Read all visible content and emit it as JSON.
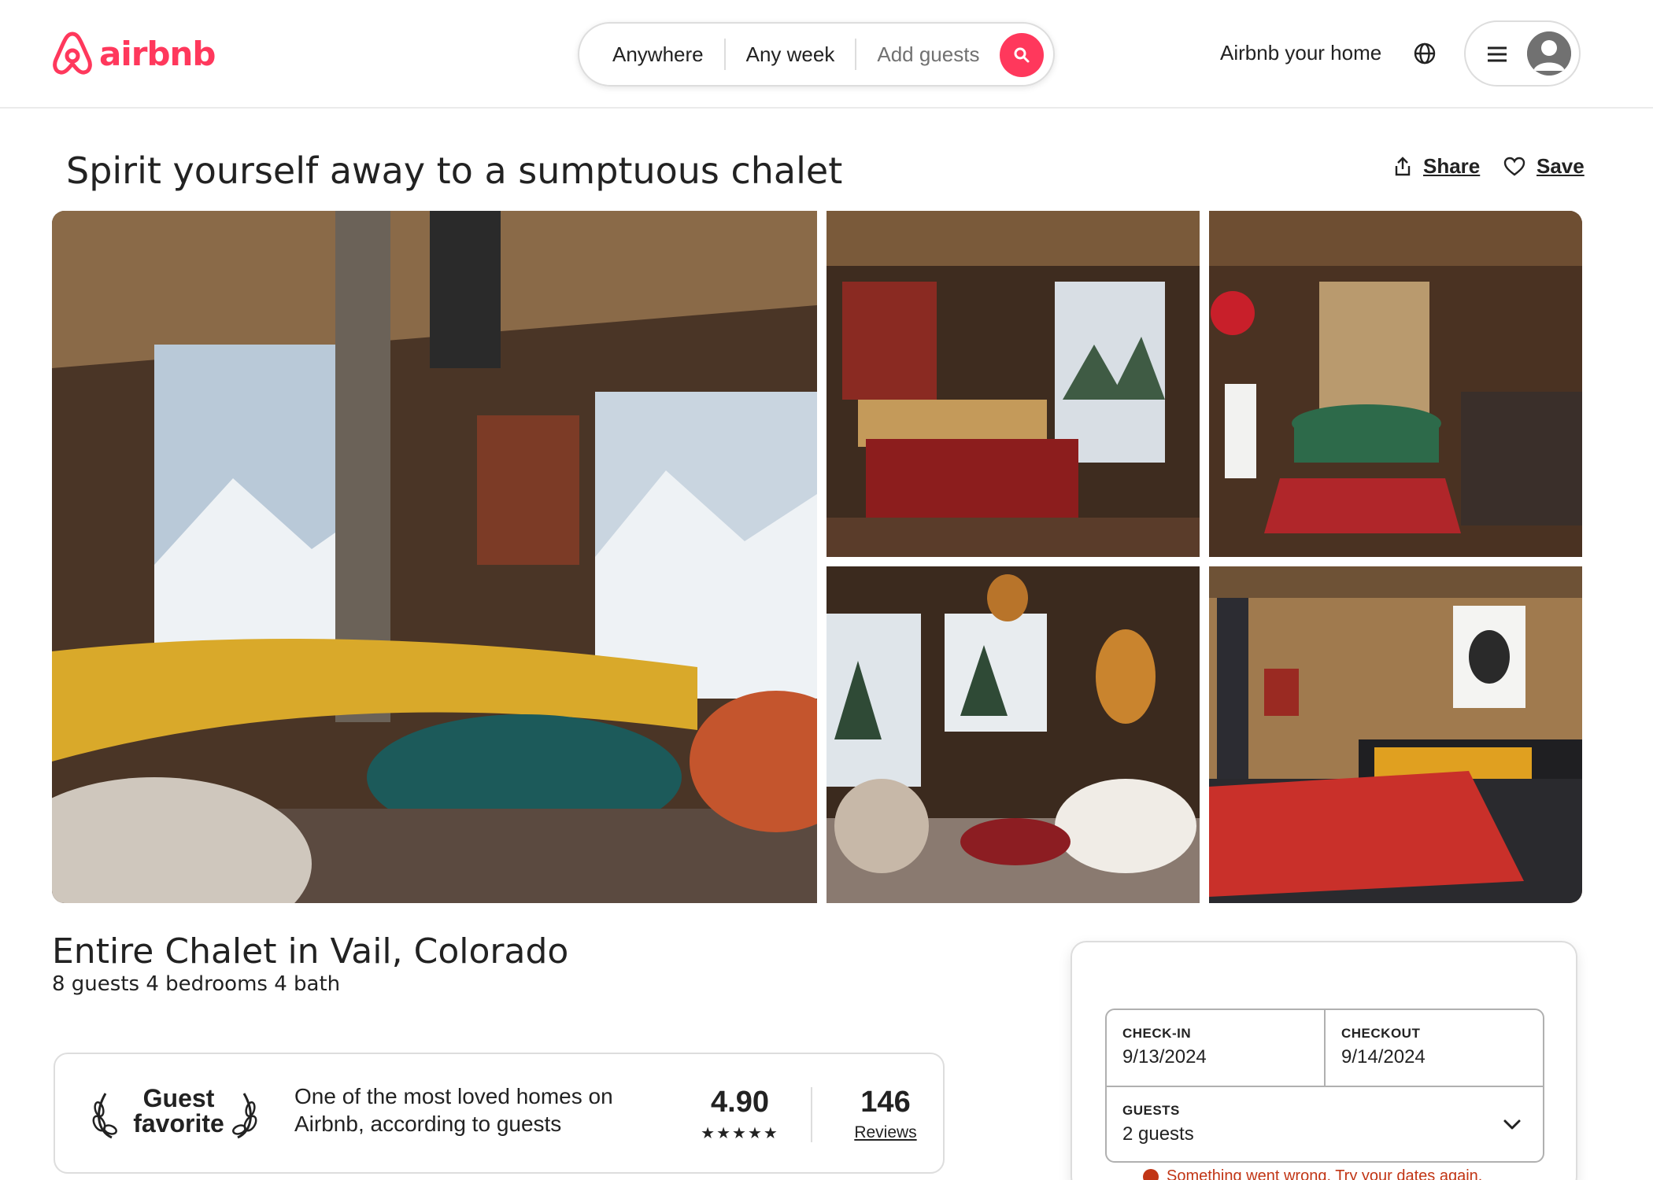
{
  "header": {
    "logo_text": "airbnb",
    "search": {
      "location": "Anywhere",
      "dates": "Any week",
      "guests_placeholder": "Add guests"
    },
    "host_link": "Airbnb your home"
  },
  "listing": {
    "title": "Spirit yourself away to a sumptuous chalet",
    "share_label": "Share",
    "save_label": "Save",
    "headline": "Entire Chalet in Vail, Colorado",
    "details": "8 guests 4 bedrooms 4 bath"
  },
  "guest_favorite": {
    "label": "Guest favorite",
    "description": "One of the most loved homes on Airbnb, according to guests",
    "rating": "4.90",
    "stars": "★★★★★",
    "reviews_count": "146",
    "reviews_label": "Reviews"
  },
  "booking": {
    "checkin_label": "CHECK-IN",
    "checkin_value": "9/13/2024",
    "checkout_label": "CHECKOUT",
    "checkout_value": "9/14/2024",
    "guests_label": "GUESTS",
    "guests_value": "2 guests",
    "error": "Something went wrong. Try your dates again."
  },
  "colors": {
    "brand": "#ff385c",
    "text": "#222222",
    "muted": "#717171",
    "border": "#dddddd",
    "error": "#c13515"
  },
  "icons": [
    "airbnb-logo-icon",
    "search-icon",
    "globe-icon",
    "menu-icon",
    "avatar-icon",
    "share-icon",
    "heart-icon",
    "laurel-icon",
    "chevron-down-icon",
    "error-icon"
  ]
}
